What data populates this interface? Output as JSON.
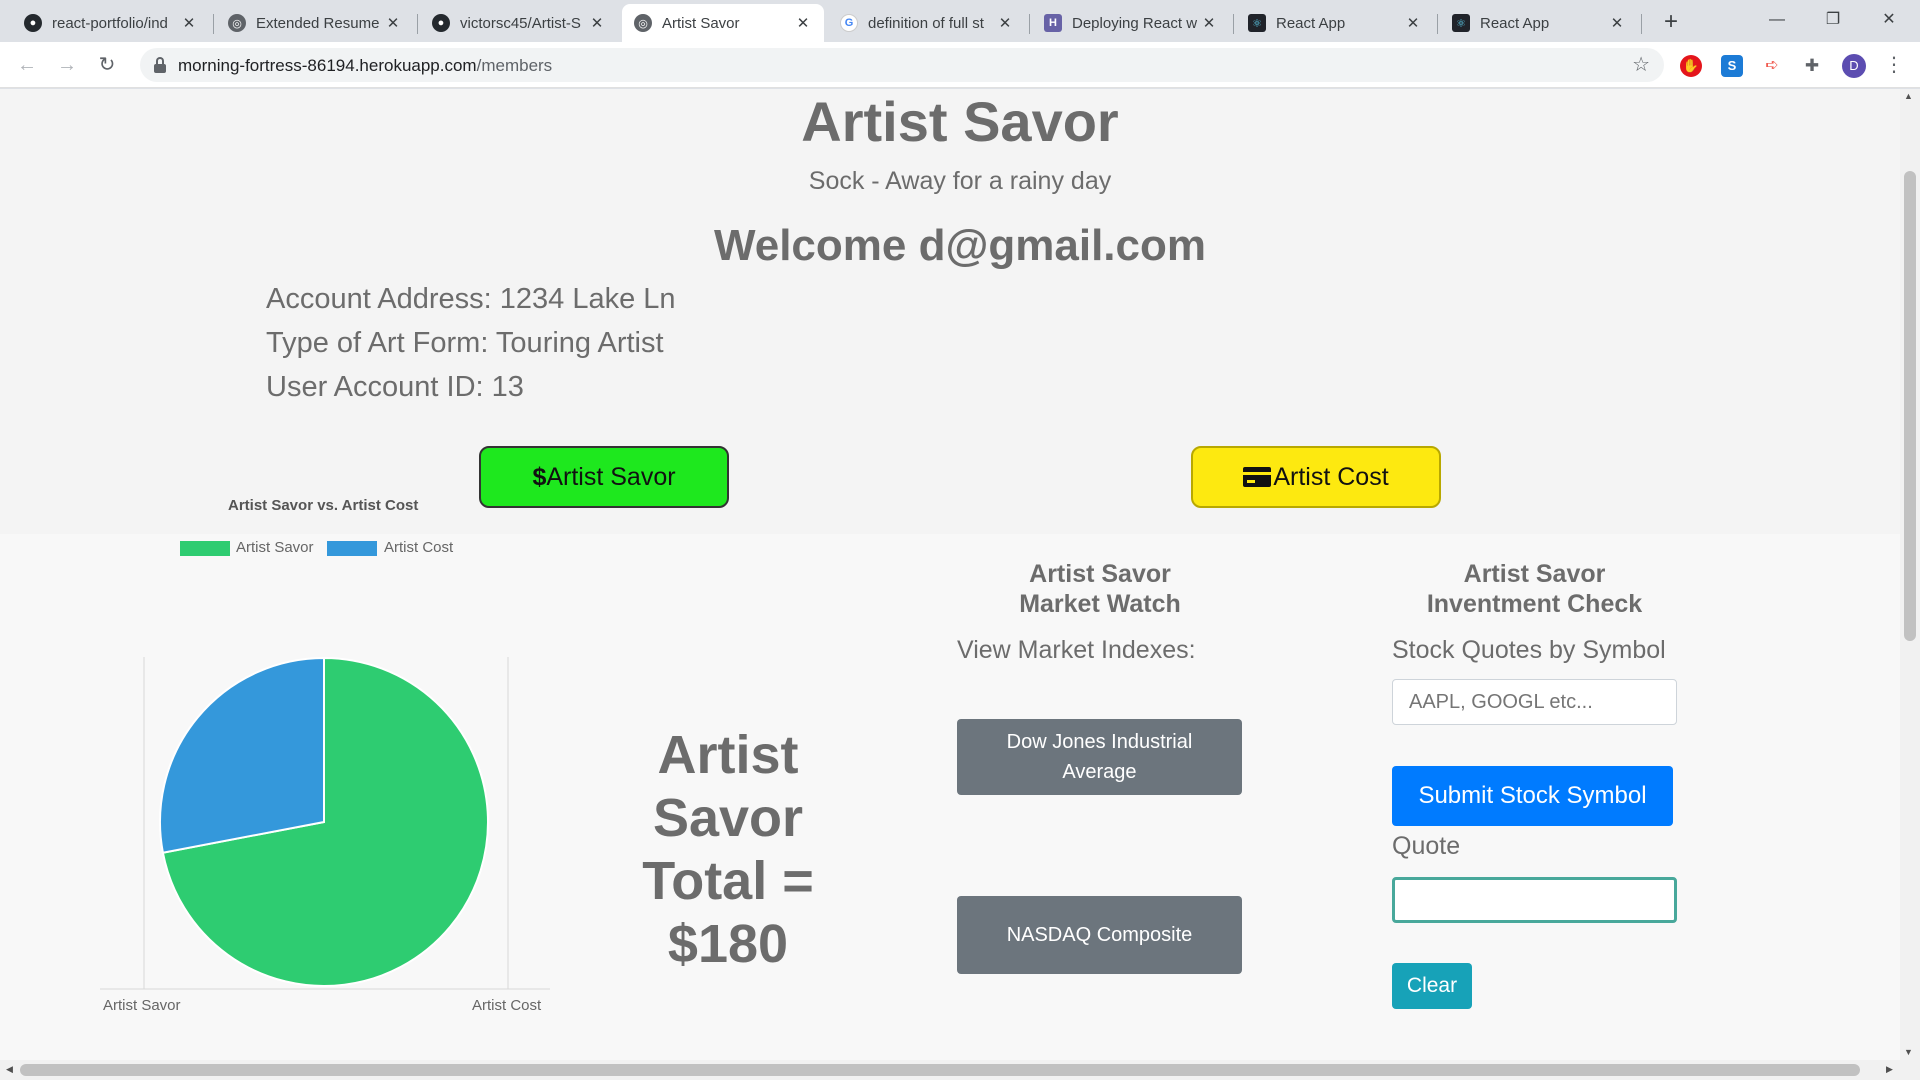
{
  "browser": {
    "tabs": [
      {
        "title": "react-portfolio/ind",
        "icon": "github-icon"
      },
      {
        "title": "Extended Resume",
        "icon": "globe-icon"
      },
      {
        "title": "victorsc45/Artist-S",
        "icon": "github-icon"
      },
      {
        "title": "Artist Savor",
        "icon": "globe-icon",
        "active": true
      },
      {
        "title": "definition of full st",
        "icon": "google-icon"
      },
      {
        "title": "Deploying React w",
        "icon": "heroku-icon"
      },
      {
        "title": "React App",
        "icon": "react-icon"
      },
      {
        "title": "React App",
        "icon": "react-icon"
      }
    ],
    "url_host": "morning-fortress-86194.herokuapp.com",
    "url_path": "/members",
    "profile_initial": "D"
  },
  "page": {
    "title": "Artist Savor",
    "subtitle": "Sock - Away for a rainy day",
    "welcome": "Welcome d@gmail.com",
    "account_address": "Account Address: 1234 Lake Ln",
    "art_form": "Type of Art Form: Touring Artist",
    "account_id": "User Account ID: 13",
    "savor_button": "Artist Savor",
    "savor_button_icon": "$",
    "cost_button": "Artist Cost",
    "total_lines": [
      "Artist",
      "Savor",
      "Total =",
      "$180"
    ],
    "market_watch": {
      "title_line1": "Artist Savor",
      "title_line2": "Market Watch",
      "subtitle": "View Market Indexes:",
      "dow_line1": "Dow Jones Industrial",
      "dow_line2": "Average",
      "nasdaq": "NASDAQ Composite"
    },
    "investment": {
      "title_line1": "Artist Savor",
      "title_line2": "Inventment Check",
      "subtitle": "Stock Quotes by Symbol",
      "placeholder": "AAPL, GOOGL etc...",
      "submit": "Submit Stock Symbol",
      "quote_label": "Quote",
      "quote_value": "",
      "clear": "Clear"
    }
  },
  "colors": {
    "savor": "#2ecc71",
    "cost": "#3498db",
    "savor_button": "#1ee81e",
    "cost_button": "#fde910"
  },
  "chart_data": {
    "type": "pie",
    "title": "Artist Savor vs. Artist Cost",
    "categories": [
      "Artist Savor",
      "Artist Cost"
    ],
    "values": [
      72,
      28
    ],
    "legend": "top",
    "xlabel": "",
    "ylabel": ""
  }
}
